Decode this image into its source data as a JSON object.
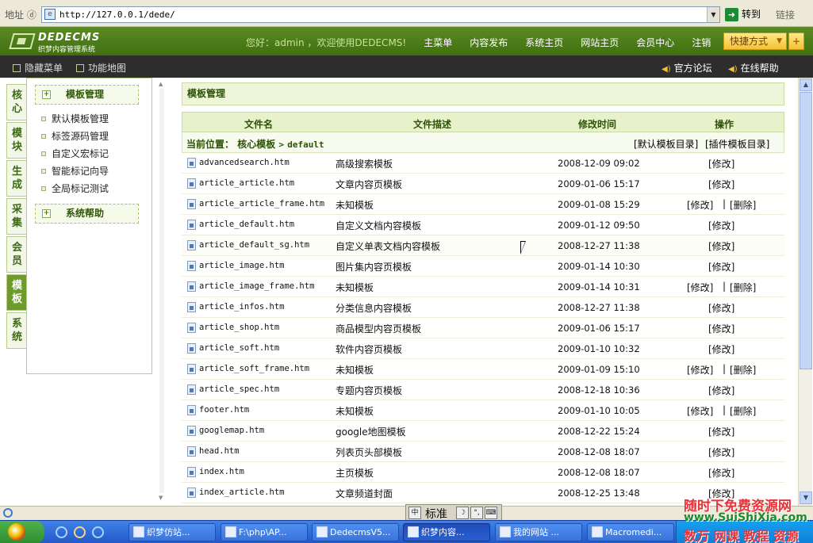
{
  "browser": {
    "address_label": "地址 ⓓ",
    "url": "http://127.0.0.1/dede/",
    "go_label": "转到",
    "links_label": "链接"
  },
  "header": {
    "logo_title": "DEDECMS",
    "logo_subtitle": "织梦内容管理系统",
    "welcome": "您好：admin ，欢迎使用DEDECMS!",
    "nav": [
      "主菜单",
      "内容发布",
      "系统主页",
      "网站主页",
      "会员中心",
      "注销"
    ],
    "quick_label": "快捷方式",
    "plus_label": "+"
  },
  "subheader": {
    "hide_menu": "隐藏菜单",
    "site_map": "功能地图",
    "forum": "官方论坛",
    "help": "在线帮助"
  },
  "vtabs": [
    "核心",
    "模块",
    "生成",
    "采集",
    "会员",
    "模板",
    "系统"
  ],
  "vtabs_active": 5,
  "leftmenu": {
    "section1_title": "模板管理",
    "section1_items": [
      "默认模板管理",
      "标签源码管理",
      "自定义宏标记",
      "智能标记向导",
      "全局标记测试"
    ],
    "section2_title": "系统帮助"
  },
  "main": {
    "page_title": "模板管理",
    "columns": [
      "文件名",
      "文件描述",
      "修改时间",
      "操作"
    ],
    "crumb_label": "当前位置：",
    "crumb_path1": "核心模板",
    "crumb_sep": ">",
    "crumb_path2": "default",
    "link_default_dir": "[默认模板目录]",
    "link_plugin_dir": "[插件模板目录]",
    "edit_label": "[修改]",
    "delete_label": "[删除]",
    "sep": "|",
    "files": [
      {
        "name": "advancedsearch.htm",
        "desc": "高级搜索模板",
        "time": "2008-12-09 09:02",
        "deletable": false
      },
      {
        "name": "article_article.htm",
        "desc": "文章内容页模板",
        "time": "2009-01-06 15:17",
        "deletable": false
      },
      {
        "name": "article_article_frame.htm",
        "desc": "未知模板",
        "time": "2009-01-08 15:29",
        "deletable": true
      },
      {
        "name": "article_default.htm",
        "desc": "自定义文档内容模板",
        "time": "2009-01-12 09:50",
        "deletable": false
      },
      {
        "name": "article_default_sg.htm",
        "desc": "自定义单表文档内容模板",
        "time": "2008-12-27 11:38",
        "deletable": false
      },
      {
        "name": "article_image.htm",
        "desc": "图片集内容页模板",
        "time": "2009-01-14 10:30",
        "deletable": false
      },
      {
        "name": "article_image_frame.htm",
        "desc": "未知模板",
        "time": "2009-01-14 10:31",
        "deletable": true
      },
      {
        "name": "article_infos.htm",
        "desc": "分类信息内容模板",
        "time": "2008-12-27 11:38",
        "deletable": false
      },
      {
        "name": "article_shop.htm",
        "desc": "商品模型内容页模板",
        "time": "2009-01-06 15:17",
        "deletable": false
      },
      {
        "name": "article_soft.htm",
        "desc": "软件内容页模板",
        "time": "2009-01-10 10:32",
        "deletable": false
      },
      {
        "name": "article_soft_frame.htm",
        "desc": "未知模板",
        "time": "2009-01-09 15:10",
        "deletable": true
      },
      {
        "name": "article_spec.htm",
        "desc": "专题内容页模板",
        "time": "2008-12-18 10:36",
        "deletable": false
      },
      {
        "name": "footer.htm",
        "desc": "未知模板",
        "time": "2009-01-10 10:05",
        "deletable": true
      },
      {
        "name": "googlemap.htm",
        "desc": "google地图模板",
        "time": "2008-12-22 15:24",
        "deletable": false
      },
      {
        "name": "head.htm",
        "desc": "列表页头部模板",
        "time": "2008-12-08 18:07",
        "deletable": false
      },
      {
        "name": "index.htm",
        "desc": "主页模板",
        "time": "2008-12-08 18:07",
        "deletable": false
      },
      {
        "name": "index_article.htm",
        "desc": "文章频道封面",
        "time": "2008-12-25 13:48",
        "deletable": false
      }
    ]
  },
  "ime": {
    "label": "标准"
  },
  "taskbar": {
    "tasks": [
      "织梦仿站...",
      "F:\\php\\AP...",
      "DedecmsV5...",
      "织梦内容...",
      "我的网站 ...",
      "Macromedi..."
    ],
    "active_index": 3
  },
  "watermark": {
    "line1": "随时下免费资源网",
    "line2": "www.SuiShiXia.com",
    "line3": "数万 网课 教程 资源"
  }
}
